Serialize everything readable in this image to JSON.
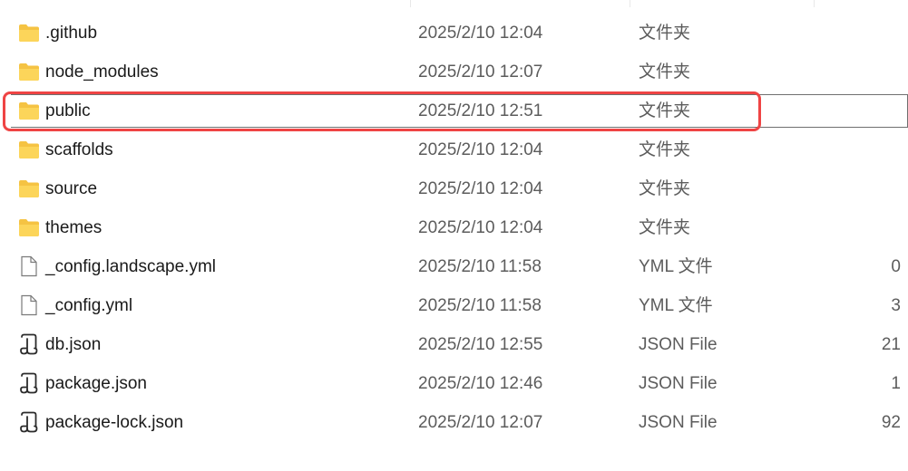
{
  "rows": [
    {
      "name": ".github",
      "date": "2025/2/10 12:04",
      "type": "文件夹",
      "size": "",
      "icon": "folder-icon"
    },
    {
      "name": "node_modules",
      "date": "2025/2/10 12:07",
      "type": "文件夹",
      "size": "",
      "icon": "folder-icon"
    },
    {
      "name": "public",
      "date": "2025/2/10 12:51",
      "type": "文件夹",
      "size": "",
      "icon": "folder-icon",
      "selected": true
    },
    {
      "name": "scaffolds",
      "date": "2025/2/10 12:04",
      "type": "文件夹",
      "size": "",
      "icon": "folder-icon"
    },
    {
      "name": "source",
      "date": "2025/2/10 12:04",
      "type": "文件夹",
      "size": "",
      "icon": "folder-icon"
    },
    {
      "name": "themes",
      "date": "2025/2/10 12:04",
      "type": "文件夹",
      "size": "",
      "icon": "folder-icon"
    },
    {
      "name": "_config.landscape.yml",
      "date": "2025/2/10 11:58",
      "type": "YML 文件",
      "size": "0",
      "icon": "file-icon"
    },
    {
      "name": "_config.yml",
      "date": "2025/2/10 11:58",
      "type": "YML 文件",
      "size": "3",
      "icon": "file-icon"
    },
    {
      "name": "db.json",
      "date": "2025/2/10 12:55",
      "type": "JSON File",
      "size": "21",
      "icon": "json-file-icon"
    },
    {
      "name": "package.json",
      "date": "2025/2/10 12:46",
      "type": "JSON File",
      "size": "1",
      "icon": "json-file-icon"
    },
    {
      "name": "package-lock.json",
      "date": "2025/2/10 12:07",
      "type": "JSON File",
      "size": "92",
      "icon": "json-file-icon"
    }
  ],
  "colors": {
    "folder": "#f5c343",
    "highlight": "#ef4444"
  }
}
